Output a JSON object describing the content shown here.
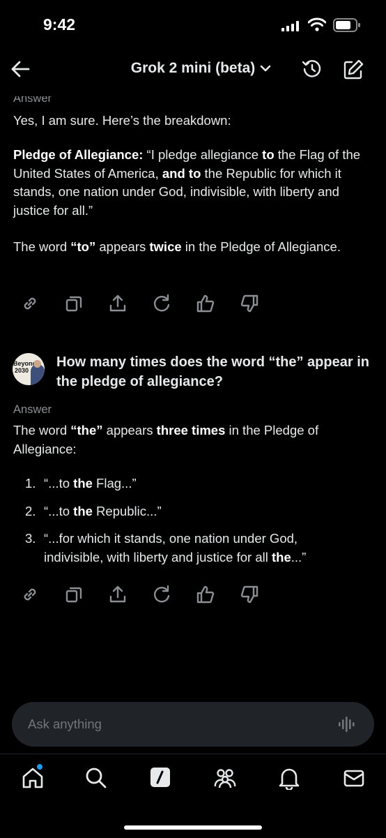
{
  "status_bar": {
    "time": "9:42"
  },
  "header": {
    "title": "Grok 2 mini (beta)"
  },
  "conversation": {
    "answer_label": "Answer",
    "first_answer": {
      "intro": "Yes, I am sure. Here’s the breakdown:",
      "pledge_label": "Pledge of Allegiance:",
      "pledge_part1": " “I pledge allegiance ",
      "pledge_to1": "to",
      "pledge_part2": " the Flag of the United States of America, ",
      "pledge_and_to": "and to",
      "pledge_part3": " the Republic for which it stands, one nation under God, indivisible, with liberty and justice for all.”",
      "summary_part1": "The word ",
      "summary_word": "“to”",
      "summary_part2": " appears ",
      "summary_count": "twice",
      "summary_part3": " in the Pledge of Allegiance."
    },
    "user_question": {
      "avatar_line1": "Beyond",
      "avatar_line2": "2030",
      "text": "How many times does the word “the” appear in the pledge of allegiance?"
    },
    "second_answer": {
      "p1": "The word ",
      "word": "“the”",
      "p2": " appears ",
      "count": "three times",
      "p3": " in the Pledge of Allegiance:",
      "items": [
        {
          "num": "1.",
          "pre": "“...to ",
          "bold": "the",
          "post": " Flag...”"
        },
        {
          "num": "2.",
          "pre": "“...to ",
          "bold": "the",
          "post": " Republic...”"
        },
        {
          "num": "3.",
          "pre": "“...for which it stands, one nation under God, indivisible, with liberty and justice for all ",
          "bold": "the",
          "post": "...”"
        }
      ]
    }
  },
  "composer": {
    "placeholder": "Ask anything"
  },
  "icons": {
    "header": [
      "back-arrow-icon",
      "chevron-down-icon",
      "history-icon",
      "new-chat-icon"
    ],
    "actions": [
      "link-icon",
      "copy-icon",
      "share-icon",
      "regenerate-icon",
      "thumbs-up-icon",
      "thumbs-down-icon"
    ],
    "tabs": [
      "home-icon",
      "search-icon",
      "grok-icon",
      "communities-icon",
      "notifications-icon",
      "messages-icon"
    ]
  },
  "colors": {
    "background": "#000000",
    "composer_bg": "#202327",
    "muted_text": "#71767b",
    "notification_dot": "#1d9bf0"
  }
}
